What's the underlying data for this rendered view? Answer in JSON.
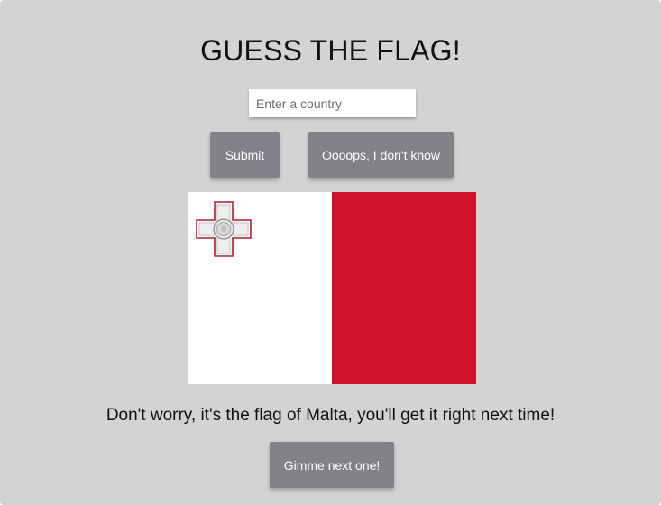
{
  "header": {
    "title": "GUESS THE FLAG!"
  },
  "guess_input": {
    "placeholder": "Enter a country",
    "value": ""
  },
  "buttons": {
    "submit_label": "Submit",
    "give_up_label": "Oooops, I don't know",
    "next_label": "Gimme next one!"
  },
  "flag": {
    "icon": "malta-flag",
    "colors": {
      "hoist": "#ffffff",
      "fly": "#cf142b"
    }
  },
  "result": {
    "message": "Don't worry, it's the flag of Malta, you'll get it right next time!"
  }
}
